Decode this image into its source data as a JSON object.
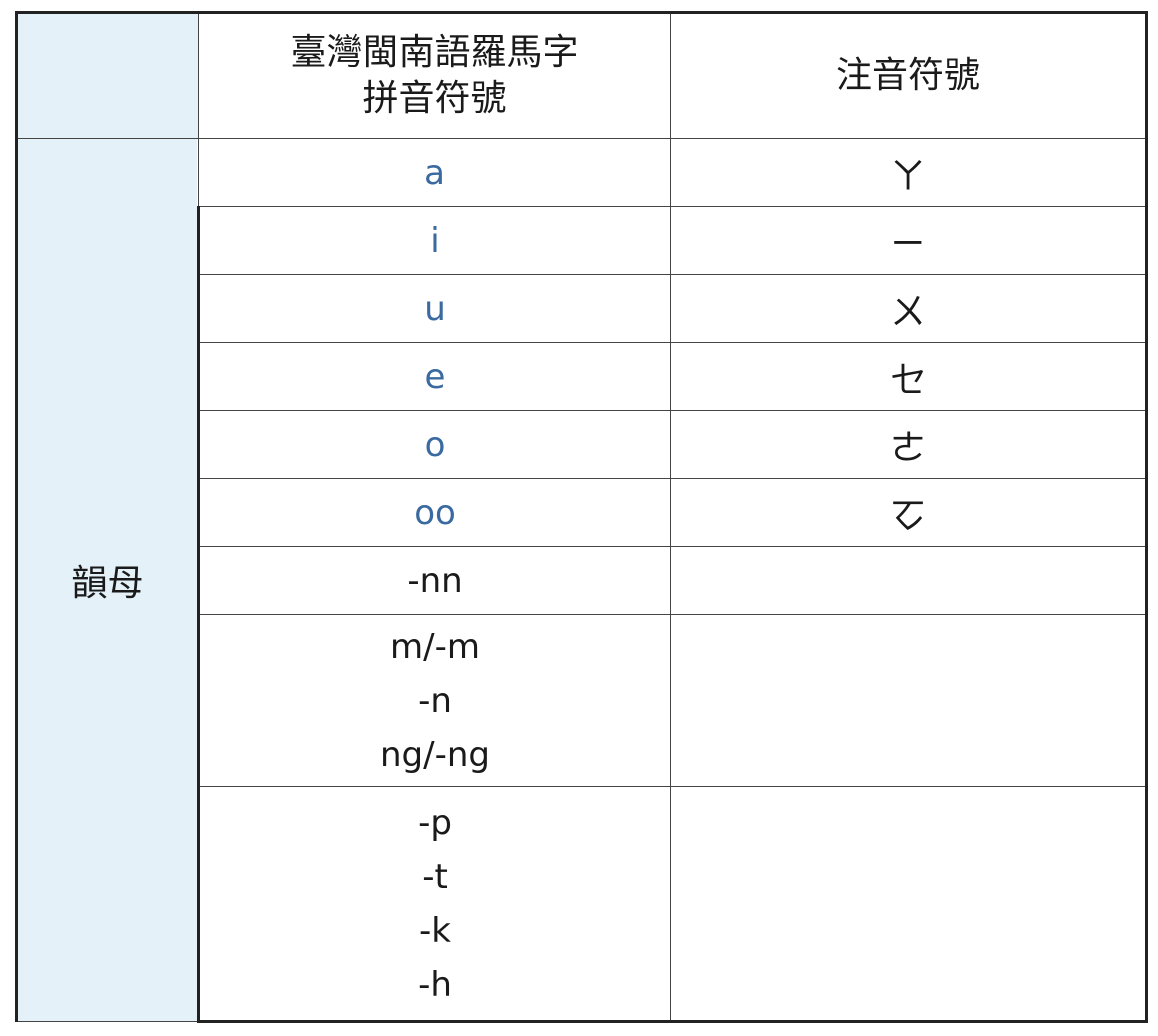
{
  "header": {
    "romanization_line1": "臺灣閩南語羅馬字",
    "romanization_line2": "拼音符號",
    "zhuyin": "注音符號"
  },
  "row_label": "韻母",
  "rows": [
    {
      "romanization": "a",
      "zhuyin": "ㄚ",
      "highlight_color": "#3a6aa0"
    },
    {
      "romanization": "i",
      "zhuyin": "ㄧ",
      "highlight_color": "#3a6aa0"
    },
    {
      "romanization": "u",
      "zhuyin": "ㄨ",
      "highlight_color": "#3a6aa0"
    },
    {
      "romanization": "e",
      "zhuyin": "ㆤ",
      "highlight_color": "#3a6aa0"
    },
    {
      "romanization": "o",
      "zhuyin": "ㄜ",
      "highlight_color": "#3a6aa0"
    },
    {
      "romanization": "oo",
      "zhuyin": "ㆦ",
      "highlight_color": "#3a6aa0"
    },
    {
      "romanization": "-nn",
      "zhuyin": ""
    }
  ],
  "nasal_group": [
    "m/-m",
    "-n",
    "ng/-ng"
  ],
  "stop_group": [
    "-p",
    "-t",
    "-k",
    "-h"
  ]
}
